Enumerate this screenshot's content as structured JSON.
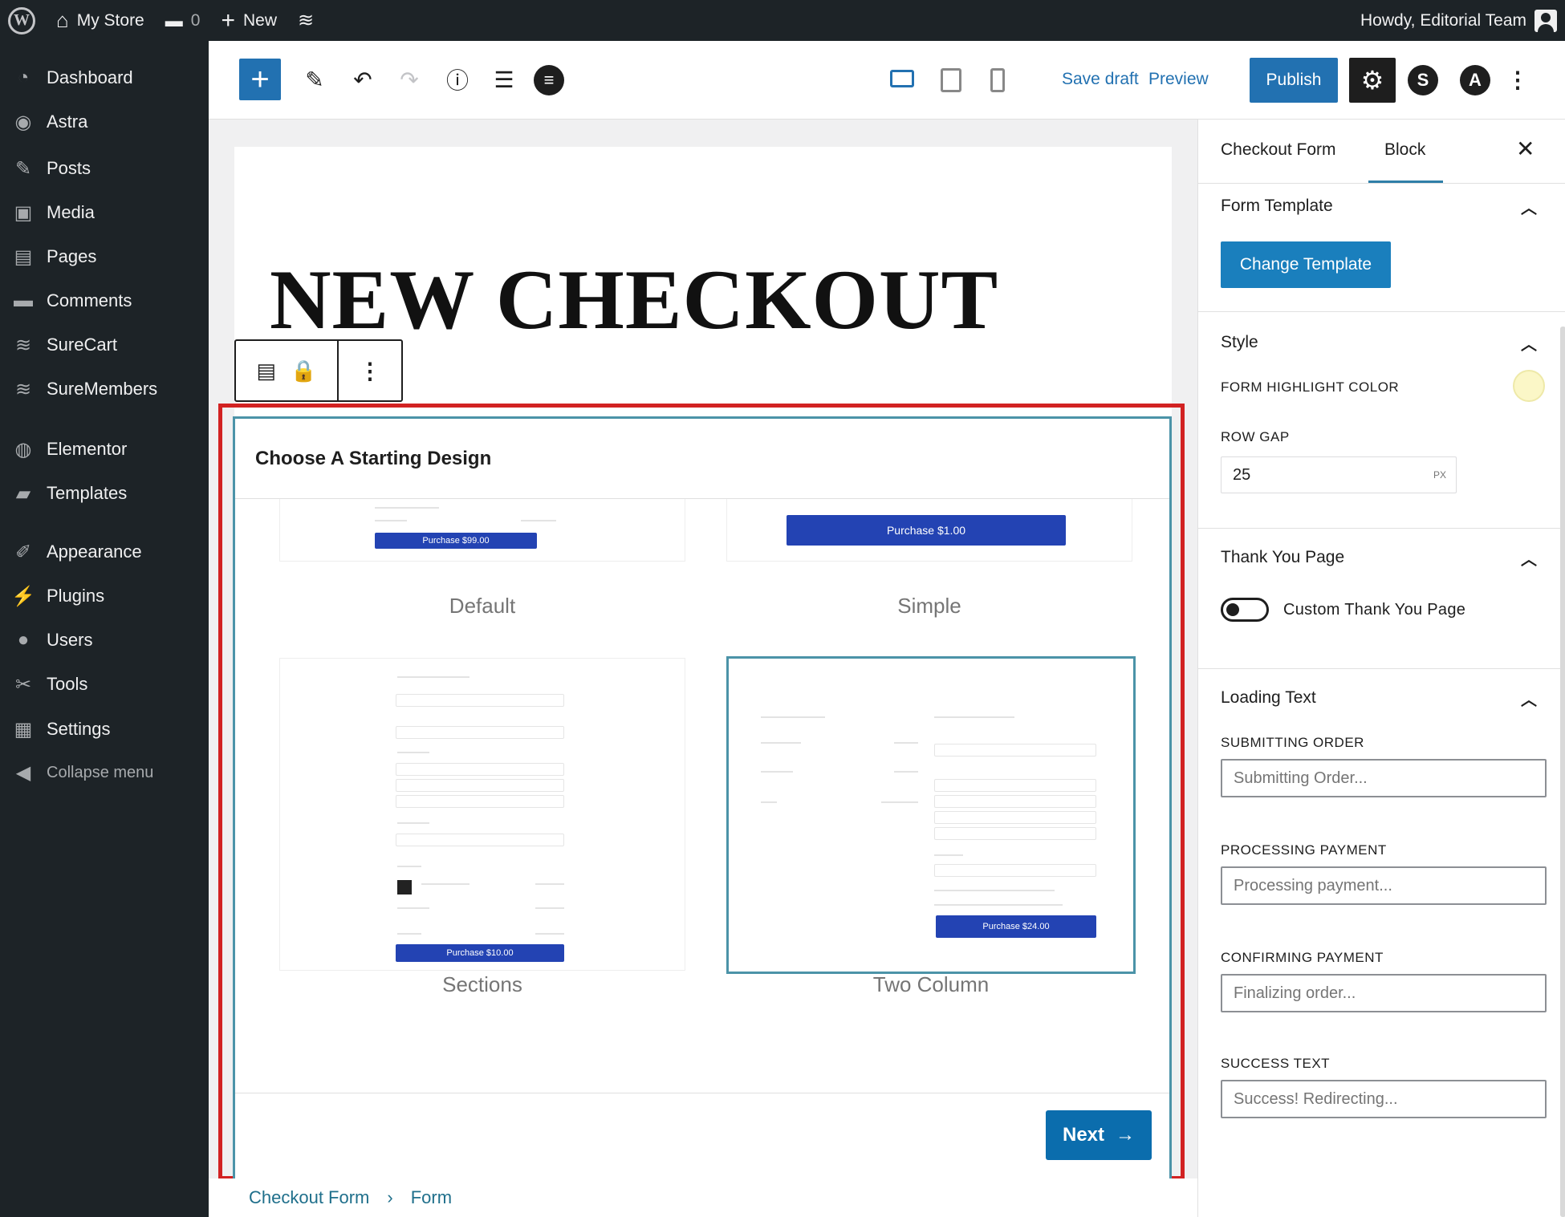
{
  "admin_bar": {
    "site_name": "My Store",
    "comments_count": "0",
    "new_label": "New",
    "greeting": "Howdy, Editorial Team"
  },
  "sidebar": {
    "items": [
      {
        "label": "Dashboard",
        "icon": "dashboard-icon"
      },
      {
        "label": "Astra",
        "icon": "astra-icon"
      },
      {
        "label": "Posts",
        "icon": "pin-icon"
      },
      {
        "label": "Media",
        "icon": "media-icon"
      },
      {
        "label": "Pages",
        "icon": "pages-icon"
      },
      {
        "label": "Comments",
        "icon": "comment-icon"
      },
      {
        "label": "SureCart",
        "icon": "surecart-icon"
      },
      {
        "label": "SureMembers",
        "icon": "suremembers-icon"
      },
      {
        "label": "Elementor",
        "icon": "elementor-icon"
      },
      {
        "label": "Templates",
        "icon": "folder-icon"
      },
      {
        "label": "Appearance",
        "icon": "brush-icon"
      },
      {
        "label": "Plugins",
        "icon": "plug-icon"
      },
      {
        "label": "Users",
        "icon": "user-icon"
      },
      {
        "label": "Tools",
        "icon": "wrench-icon"
      },
      {
        "label": "Settings",
        "icon": "settings-icon"
      },
      {
        "label": "Collapse menu",
        "icon": "collapse-icon"
      }
    ]
  },
  "toolbar": {
    "save_draft": "Save draft",
    "preview": "Preview",
    "publish": "Publish"
  },
  "canvas": {
    "page_title": "NEW CHECKOUT",
    "panel_title": "Choose A Starting Design",
    "designs": [
      {
        "label": "Default",
        "button": "Purchase $99.00"
      },
      {
        "label": "Simple",
        "button": "Purchase $1.00"
      },
      {
        "label": "Sections",
        "button": "Purchase $10.00"
      },
      {
        "label": "Two Column",
        "button": "Purchase $24.00"
      }
    ],
    "next_label": "Next"
  },
  "breadcrumb": {
    "items": [
      "Checkout Form",
      "Form"
    ],
    "separator": "›"
  },
  "inspector": {
    "tabs": [
      "Checkout Form",
      "Block"
    ],
    "form_template": {
      "title": "Form Template",
      "button": "Change Template"
    },
    "style": {
      "title": "Style",
      "highlight_label": "FORM HIGHLIGHT COLOR",
      "highlight_color": "#fbf7c7",
      "row_gap_label": "ROW GAP",
      "row_gap_value": "25",
      "row_gap_unit": "PX"
    },
    "thank_you": {
      "title": "Thank You Page",
      "toggle_label": "Custom Thank You Page"
    },
    "loading_text": {
      "title": "Loading Text",
      "fields": [
        {
          "label": "SUBMITTING ORDER",
          "placeholder": "Submitting Order..."
        },
        {
          "label": "PROCESSING PAYMENT",
          "placeholder": "Processing payment..."
        },
        {
          "label": "CONFIRMING PAYMENT",
          "placeholder": "Finalizing order..."
        },
        {
          "label": "SUCCESS TEXT",
          "placeholder": "Success! Redirecting..."
        }
      ]
    }
  },
  "colors": {
    "accent": "#2271b1",
    "selection_frame": "#d22222",
    "admin_bg": "#1d2327"
  }
}
